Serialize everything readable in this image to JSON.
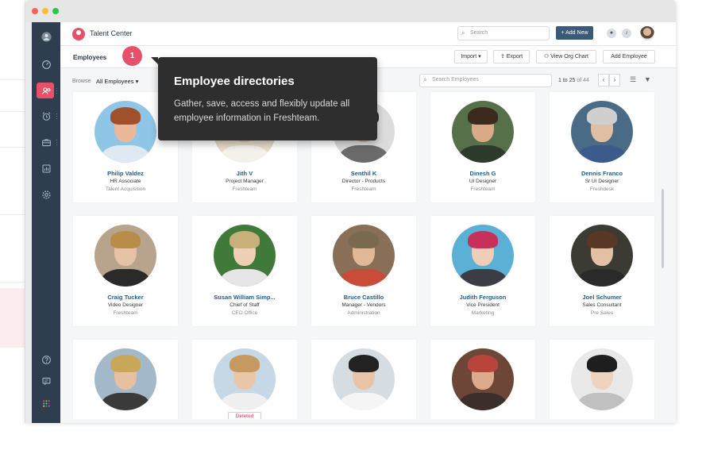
{
  "app": {
    "title": "Talent Center"
  },
  "topbar": {
    "search_placeholder": "Search",
    "add_new_label": "+ Add New"
  },
  "subbar": {
    "title": "Employees",
    "buttons": {
      "import": "Import ▾",
      "export": "Export",
      "org_chart": "View Org Chart",
      "add_employee": "Add Employee"
    }
  },
  "tooltip": {
    "step": "1",
    "title": "Employee directories",
    "text": "Gather, save, access and flexibly update all employee information in Freshteam."
  },
  "filterbar": {
    "browse_label": "Browse",
    "browse_value": "All Employees ▾",
    "search_placeholder": "Search Employees",
    "pager_range": "1 to 25",
    "pager_of": " of 44"
  },
  "employees": [
    {
      "name": "Philip Valdez",
      "role": "HR Associate",
      "dept": "Talent Acquisition"
    },
    {
      "name": "Jith V",
      "role": "Project Manager",
      "dept": "Freshteam"
    },
    {
      "name": "Senthil K",
      "role": "Director - Products",
      "dept": "Freshteam"
    },
    {
      "name": "Dinesh G",
      "role": "UI Designer",
      "dept": "Freshteam"
    },
    {
      "name": "Dennis Franco",
      "role": "Sr UI Designer",
      "dept": "Freshdesk"
    },
    {
      "name": "Craig Tucker",
      "role": "Video Designer",
      "dept": "Freshteam"
    },
    {
      "name": "Susan William Simp...",
      "role": "Chief of Staff",
      "dept": "CEO Office"
    },
    {
      "name": "Bruce Castillo",
      "role": "Manager - Vendors",
      "dept": "Administration"
    },
    {
      "name": "Judith Ferguson",
      "role": "Vice President",
      "dept": "Marketing"
    },
    {
      "name": "Joel Schumer",
      "role": "Sales Consultant",
      "dept": "Pre Sales"
    },
    {
      "name": "",
      "role": "",
      "dept": ""
    },
    {
      "name": "",
      "role": "",
      "dept": "",
      "badge": "Deleted"
    },
    {
      "name": "",
      "role": "",
      "dept": ""
    },
    {
      "name": "",
      "role": "",
      "dept": ""
    },
    {
      "name": "",
      "role": "",
      "dept": ""
    }
  ]
}
